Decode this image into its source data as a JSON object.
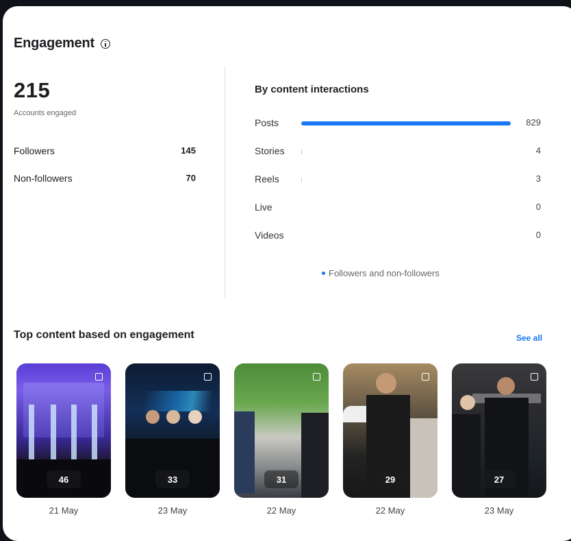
{
  "engagement": {
    "title": "Engagement",
    "accounts_engaged": "215",
    "accounts_engaged_label": "Accounts engaged",
    "followers_label": "Followers",
    "followers_value": "145",
    "non_followers_label": "Non-followers",
    "non_followers_value": "70"
  },
  "content_interactions": {
    "title": "By content interactions",
    "rows": [
      {
        "label": "Posts",
        "value": "829",
        "fraction": 1.0
      },
      {
        "label": "Stories",
        "value": "4",
        "fraction": 0.005
      },
      {
        "label": "Reels",
        "value": "3",
        "fraction": 0.004
      },
      {
        "label": "Live",
        "value": "0",
        "fraction": 0
      },
      {
        "label": "Videos",
        "value": "0",
        "fraction": 0
      }
    ],
    "legend": "Followers and non-followers"
  },
  "top_content": {
    "title": "Top content based on engagement",
    "see_all": "See all",
    "items": [
      {
        "count": "46",
        "date": "21 May"
      },
      {
        "count": "33",
        "date": "23 May"
      },
      {
        "count": "31",
        "date": "22 May"
      },
      {
        "count": "29",
        "date": "22 May"
      },
      {
        "count": "27",
        "date": "23 May"
      }
    ]
  },
  "colors": {
    "accent": "#1877f2",
    "card_background": "#ffffff",
    "page_background": "#0f1219"
  }
}
